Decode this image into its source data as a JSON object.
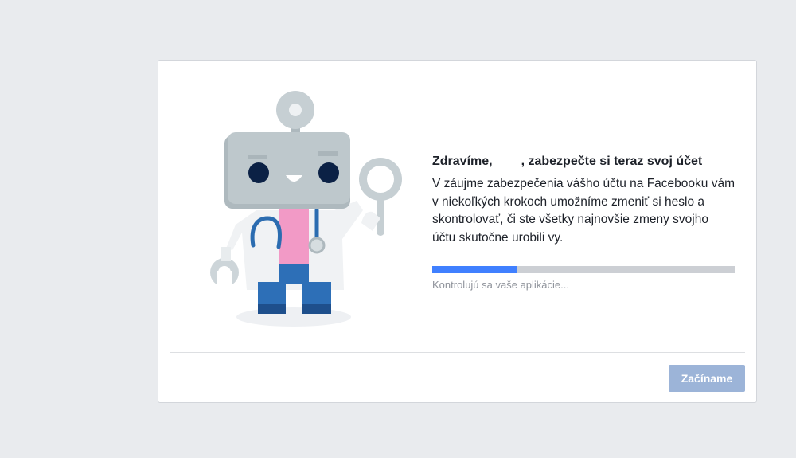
{
  "dialog": {
    "greeting": "Zdravíme,",
    "user_name": "",
    "heading_rest": ", zabezpečte si teraz svoj účet",
    "body": "V záujme zabezpečenia vášho účtu na Facebooku vám v niekoľkých krokoch umožníme zmeniť si heslo a skontrolovať, či ste všetky najnovšie zmeny svojho účtu skutočne urobili vy.",
    "progress_fraction": 0.28,
    "status": "Kontrolujú sa vaše aplikácie...",
    "start_label": "Začíname"
  },
  "illustration": {
    "name": "doctor-robot-illustration"
  },
  "colors": {
    "page_background": "#e9ebee",
    "progress_fill": "#4080ff",
    "progress_track": "#cccfd4",
    "button_disabled": "#9cb4d8",
    "robot_head": "#bec8cc",
    "robot_eyes": "#0b2145",
    "shirt": "#f29ac6",
    "pants": "#2d6fb7"
  }
}
